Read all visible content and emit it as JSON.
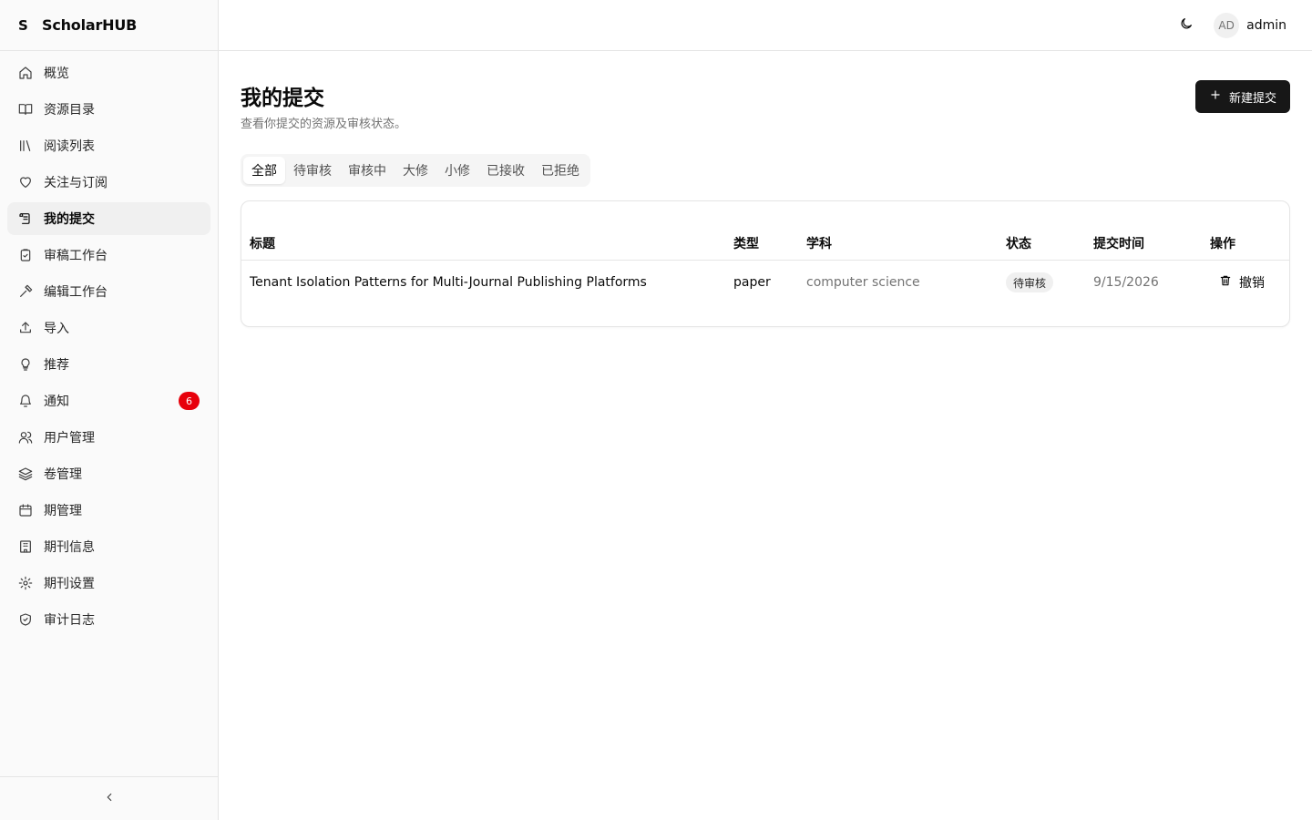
{
  "brand": {
    "mark": "S",
    "name": "ScholarHUB"
  },
  "sidebar": {
    "items": [
      {
        "label": "概览",
        "icon": "home-icon"
      },
      {
        "label": "资源目录",
        "icon": "book-open-icon"
      },
      {
        "label": "阅读列表",
        "icon": "library-icon"
      },
      {
        "label": "关注与订阅",
        "icon": "heart-icon"
      },
      {
        "label": "我的提交",
        "icon": "scroll-icon",
        "active": true
      },
      {
        "label": "审稿工作台",
        "icon": "clipboard-check-icon"
      },
      {
        "label": "编辑工作台",
        "icon": "hammer-icon"
      },
      {
        "label": "导入",
        "icon": "upload-icon"
      },
      {
        "label": "推荐",
        "icon": "lightbulb-icon"
      },
      {
        "label": "通知",
        "icon": "bell-icon",
        "badge": "6"
      },
      {
        "label": "用户管理",
        "icon": "users-icon"
      },
      {
        "label": "卷管理",
        "icon": "layers-icon"
      },
      {
        "label": "期管理",
        "icon": "calendar-icon"
      },
      {
        "label": "期刊信息",
        "icon": "building-icon"
      },
      {
        "label": "期刊设置",
        "icon": "gear-icon"
      },
      {
        "label": "审计日志",
        "icon": "shield-check-icon"
      }
    ],
    "collapse_icon": "chevron-left-icon"
  },
  "topbar": {
    "theme_icon": "moon-icon",
    "avatar_initials": "AD",
    "username": "admin"
  },
  "page": {
    "title": "我的提交",
    "subtitle": "查看你提交的资源及审核状态。",
    "new_button_label": "新建提交"
  },
  "tabs": [
    {
      "label": "全部",
      "active": true
    },
    {
      "label": "待审核"
    },
    {
      "label": "审核中"
    },
    {
      "label": "大修"
    },
    {
      "label": "小修"
    },
    {
      "label": "已接收"
    },
    {
      "label": "已拒绝"
    }
  ],
  "table": {
    "headers": [
      "标题",
      "类型",
      "学科",
      "状态",
      "提交时间",
      "操作"
    ],
    "rows": [
      {
        "title": "Tenant Isolation Patterns for Multi-Journal Publishing Platforms",
        "type": "paper",
        "subject": "computer science",
        "status": "待审核",
        "submitted": "9/15/2026",
        "action": "撤销"
      }
    ]
  },
  "colors": {
    "accent": "#171717",
    "badge": "#e7000b"
  }
}
